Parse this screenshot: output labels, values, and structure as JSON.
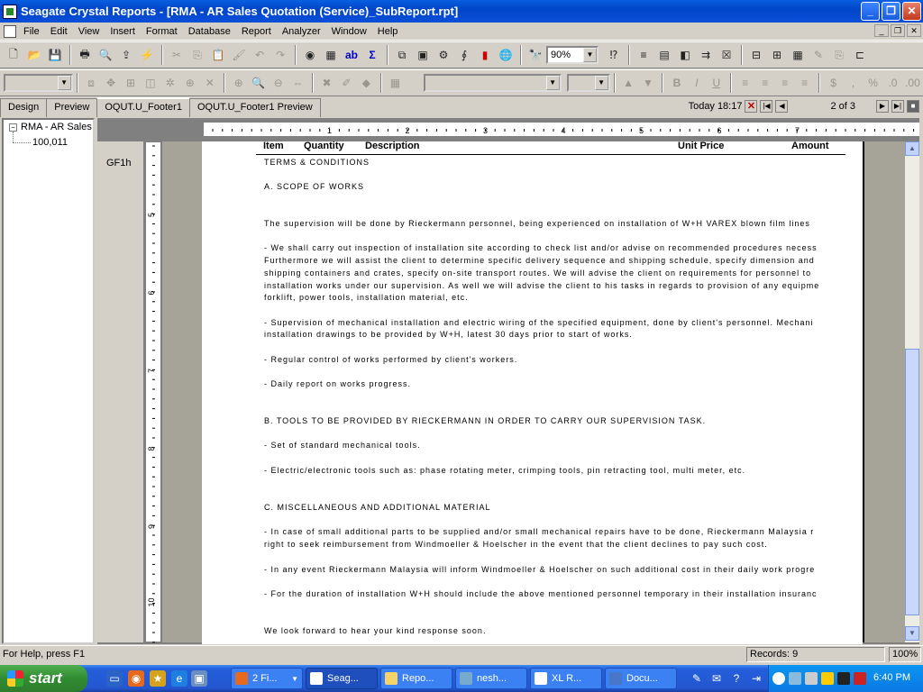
{
  "window": {
    "title": "Seagate Crystal Reports - [RMA - AR Sales Quotation (Service)_SubReport.rpt]"
  },
  "menu": [
    "File",
    "Edit",
    "View",
    "Insert",
    "Format",
    "Database",
    "Report",
    "Analyzer",
    "Window",
    "Help"
  ],
  "toolbar": {
    "zoom": "90%"
  },
  "tabs": [
    "Design",
    "Preview",
    "OQUT.U_Footer1",
    "OQUT.U_Footer1 Preview"
  ],
  "nav": {
    "today_label": "Today",
    "time": "18:17",
    "page": "2 of 3"
  },
  "tree": {
    "root": "RMA - AR Sales",
    "child": "100,011"
  },
  "section_label": "GF1h",
  "report": {
    "headers": {
      "item": "Item",
      "quantity": "Quantity",
      "description": "Description",
      "unit_price": "Unit Price",
      "amount": "Amount"
    },
    "lines": [
      "TERMS & CONDITIONS",
      "A. SCOPE OF WORKS",
      "The supervision will be done by Rieckermann personnel, being experienced on installation of W+H VAREX blown film lines",
      "- We shall carry out inspection of installation site according to check list and/or advise on recommended procedures necess",
      "Furthermore we will assist the client to determine specific delivery sequence and shipping schedule, specify dimension and",
      "shipping containers and crates, specify on-site transport routes. We will advise the client on requirements for personnel to",
      "installation works under our supervision. As well we will advise the client to his tasks in regards to provision of any equipme",
      "forklift, power tools, installation material, etc.",
      "- Supervision of mechanical installation and electric wiring of the specified equipment, done by client's personnel. Mechani",
      "installation drawings to be provided by W+H, latest 30 days prior to start of works.",
      "- Regular control of works performed by client's workers.",
      "- Daily report on works progress.",
      "B. TOOLS TO BE PROVIDED BY RIECKERMANN IN ORDER TO CARRY OUR SUPERVISION TASK.",
      "- Set of standard mechanical tools.",
      "- Electric/electronic tools such as: phase rotating meter, crimping tools, pin retracting tool, multi meter, etc.",
      "C. MISCELLANEOUS AND ADDITIONAL MATERIAL",
      "- In case of small additional parts to be supplied and/or small mechanical repairs have to be done, Rieckermann Malaysia r",
      "right to seek reimbursement from Windmoeller & Hoelscher in the event that the client declines to pay such cost.",
      "- In any event Rieckermann Malaysia will inform Windmoeller & Hoelscher on such additional cost in their daily work progre",
      "- For the duration of installation W+H should include the above mentioned personnel temporary in their installation insuranc",
      "We look forward to hear your kind response soon."
    ]
  },
  "ruler": {
    "h": [
      "1",
      "2",
      "3",
      "4",
      "5",
      "6",
      "7"
    ],
    "v": [
      "5",
      "6",
      "7",
      "8",
      "9",
      "10"
    ]
  },
  "status": {
    "help": "For Help, press F1",
    "records": "Records: 9",
    "zoom": "100%"
  },
  "taskbar": {
    "start": "start",
    "tasks": [
      "2 Fi...",
      "Seag...",
      "Repo...",
      "nesh...",
      "XL R...",
      "Docu..."
    ],
    "clock": "6:40 PM"
  }
}
